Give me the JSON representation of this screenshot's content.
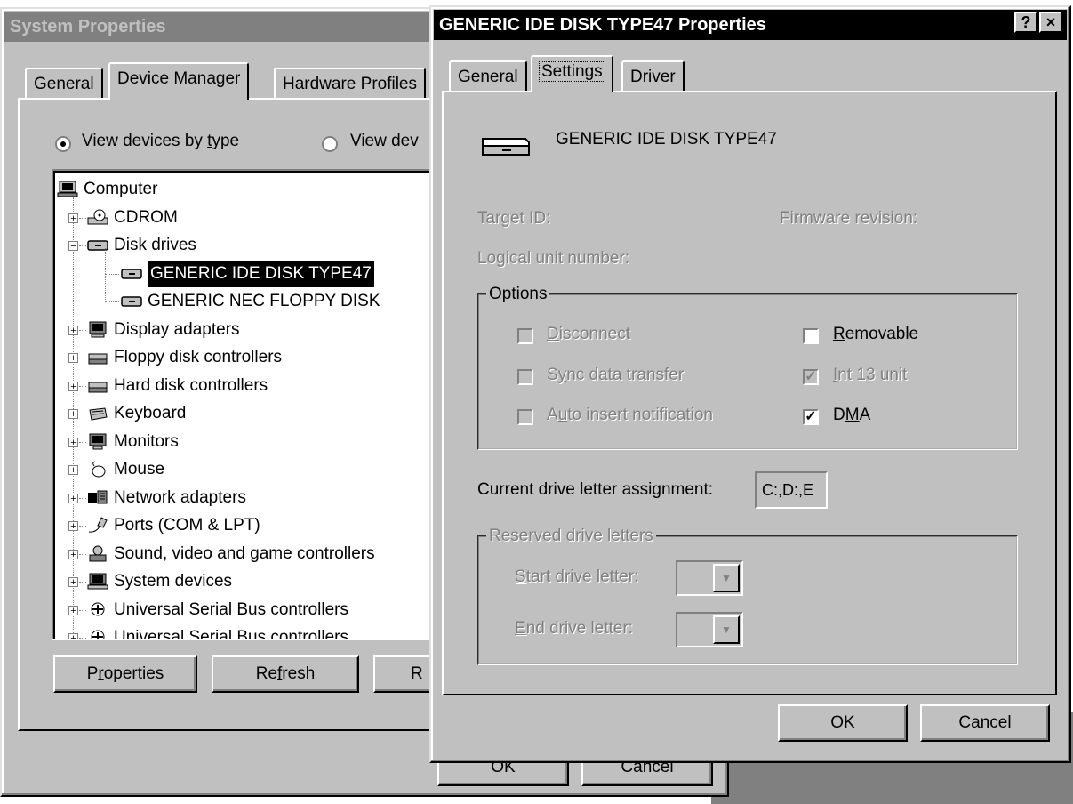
{
  "back_window": {
    "title": "System Properties",
    "tabs": [
      "General",
      "Device Manager",
      "Hardware Profiles"
    ],
    "view_by_type": "View devices by type",
    "view_by_connection": "View dev",
    "tree": [
      {
        "label": "Computer",
        "icon": "computer-icon",
        "expander": "",
        "level": 0
      },
      {
        "label": "CDROM",
        "icon": "cdrom-icon",
        "expander": "+",
        "level": 1
      },
      {
        "label": "Disk drives",
        "icon": "disk-drive-icon",
        "expander": "−",
        "level": 1
      },
      {
        "label": "GENERIC IDE  DISK TYPE47",
        "icon": "disk-drive-icon",
        "expander": "",
        "level": 2,
        "selected": true
      },
      {
        "label": "GENERIC NEC  FLOPPY DISK",
        "icon": "disk-drive-icon",
        "expander": "",
        "level": 2
      },
      {
        "label": "Display adapters",
        "icon": "display-adapter-icon",
        "expander": "+",
        "level": 1
      },
      {
        "label": "Floppy disk controllers",
        "icon": "floppy-controller-icon",
        "expander": "+",
        "level": 1
      },
      {
        "label": "Hard disk controllers",
        "icon": "hdd-controller-icon",
        "expander": "+",
        "level": 1
      },
      {
        "label": "Keyboard",
        "icon": "keyboard-icon",
        "expander": "+",
        "level": 1
      },
      {
        "label": "Monitors",
        "icon": "monitor-icon",
        "expander": "+",
        "level": 1
      },
      {
        "label": "Mouse",
        "icon": "mouse-icon",
        "expander": "+",
        "level": 1
      },
      {
        "label": "Network adapters",
        "icon": "network-adapter-icon",
        "expander": "+",
        "level": 1
      },
      {
        "label": "Ports (COM & LPT)",
        "icon": "port-icon",
        "expander": "+",
        "level": 1
      },
      {
        "label": "Sound, video and game controllers",
        "icon": "sound-icon",
        "expander": "+",
        "level": 1
      },
      {
        "label": "System devices",
        "icon": "system-device-icon",
        "expander": "+",
        "level": 1
      },
      {
        "label": "Universal Serial Bus controllers",
        "icon": "usb-icon",
        "expander": "+",
        "level": 1
      },
      {
        "label": "Universal Serial Bus controllers",
        "icon": "usb-icon",
        "expander": "+",
        "level": 1
      }
    ],
    "buttons": {
      "properties": "Properties",
      "refresh": "Refresh",
      "remove": "R",
      "ok": "OK",
      "cancel": "Cancel"
    }
  },
  "front_window": {
    "title": "GENERIC IDE  DISK TYPE47 Properties",
    "help_btn": "?",
    "close_btn": "×",
    "tabs": [
      "General",
      "Settings",
      "Driver"
    ],
    "device_name": "GENERIC IDE  DISK TYPE47",
    "target_id": "Target ID:",
    "firmware_revision": "Firmware revision:",
    "logical_unit": "Logical unit number:",
    "options_label": "Options",
    "options": {
      "disconnect": {
        "label": "Disconnect",
        "checked": false,
        "enabled": false
      },
      "sync": {
        "label": "Sync data transfer",
        "checked": false,
        "enabled": false
      },
      "auto_insert": {
        "label": "Auto insert notification",
        "checked": false,
        "enabled": false
      },
      "removable": {
        "label": "Removable",
        "checked": false,
        "enabled": true
      },
      "int13": {
        "label": "Int 13 unit",
        "checked": true,
        "enabled": false
      },
      "dma": {
        "label": "DMA",
        "checked": true,
        "enabled": true
      }
    },
    "drive_letter_label": "Current drive letter assignment:",
    "drive_letter_value": "C:,D:,E",
    "reserved_label": "Reserved drive letters",
    "start_label": "Start drive letter:",
    "end_label": "End drive letter:",
    "ok": "OK",
    "cancel": "Cancel"
  },
  "colors": {
    "face": "#c0c0c0",
    "shadow": "#808080",
    "title_active": "#000000",
    "title_inactive": "#808080"
  }
}
